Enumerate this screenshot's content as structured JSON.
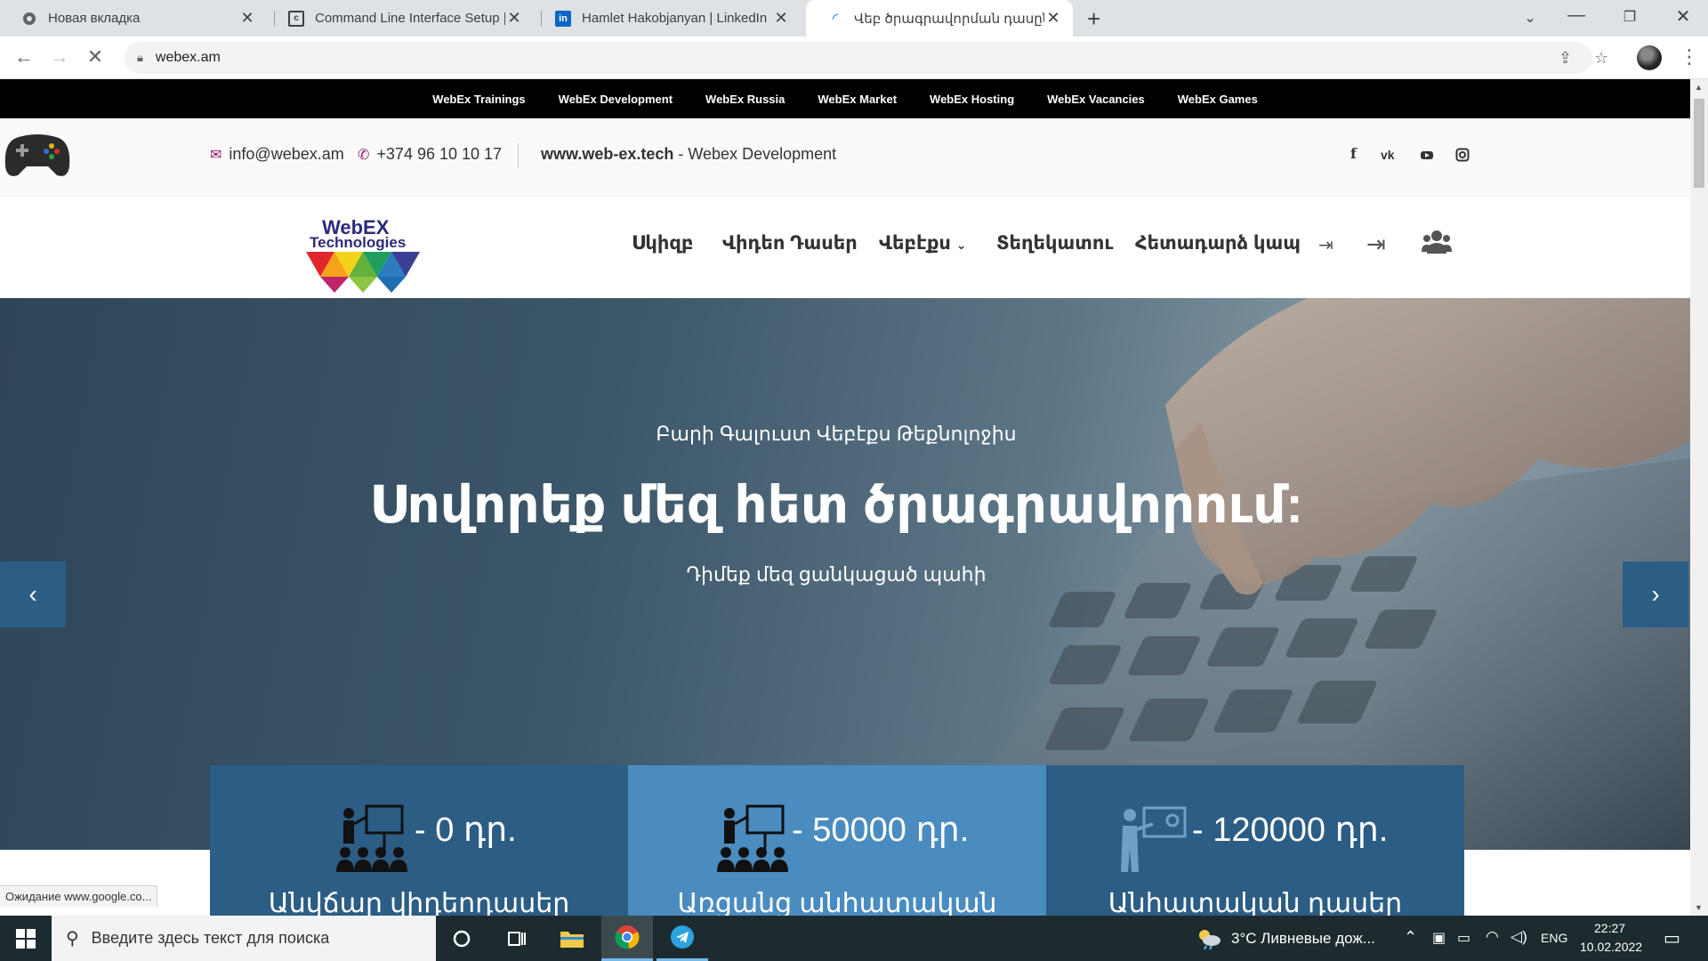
{
  "browser": {
    "tabs": [
      {
        "title": "Новая вкладка",
        "icon": "chrome-icon"
      },
      {
        "title": "Command Line Interface Setup | ",
        "icon": "docs-icon"
      },
      {
        "title": "Hamlet Hakobjanyan | LinkedIn",
        "icon": "linkedin-icon"
      },
      {
        "title": "Վեբ ծրագրավորման դասընթ",
        "icon": "loading-icon"
      }
    ],
    "url": "webex.am",
    "status_text": "Ожидание www.google.co..."
  },
  "site": {
    "topnav": [
      "WebEx Trainings",
      "WebEx Development",
      "WebEx Russia",
      "WebEx Market",
      "WebEx Hosting",
      "WebEx Vacancies",
      "WebEx Games"
    ],
    "email": "info@webex.am",
    "phone": "+374 96 10 10 17",
    "site_link": "www.web-ex.tech",
    "site_link_suffix": " - Webex Development",
    "social": [
      "facebook-icon",
      "vk-icon",
      "youtube-icon",
      "instagram-icon"
    ],
    "logo_line1": "WebEX",
    "logo_line2": "Technologies",
    "menu": [
      "Սկիզբ",
      "Վիդեո Դասեր",
      "Վեբէքս",
      "Տեղեկատու",
      "Հետադարձ կապ"
    ],
    "hero": {
      "kicker": "Բարի Գալուստ Վեբէքս Թեքնոլոջիս",
      "title": "Սովորեք մեզ հետ ծրագրավորում:",
      "subtitle": "Դիմեք մեզ ցանկացած պահի"
    },
    "prices": [
      {
        "price": "- 0 դր.",
        "caption": "Անվճար վիդեոդասեր",
        "color": "#2c5d85"
      },
      {
        "price": "- 50000 դր.",
        "caption": "Առցանց անհատական",
        "color": "#4a8cc0"
      },
      {
        "price": "- 120000 դր.",
        "caption": "Անհատական դասեր",
        "color": "#2c5d85"
      }
    ]
  },
  "taskbar": {
    "search_placeholder": "Введите здесь текст для поиска",
    "weather": "3°C  Ливневые дож...",
    "lang": "ENG",
    "time": "22:27",
    "date": "10.02.2022"
  }
}
